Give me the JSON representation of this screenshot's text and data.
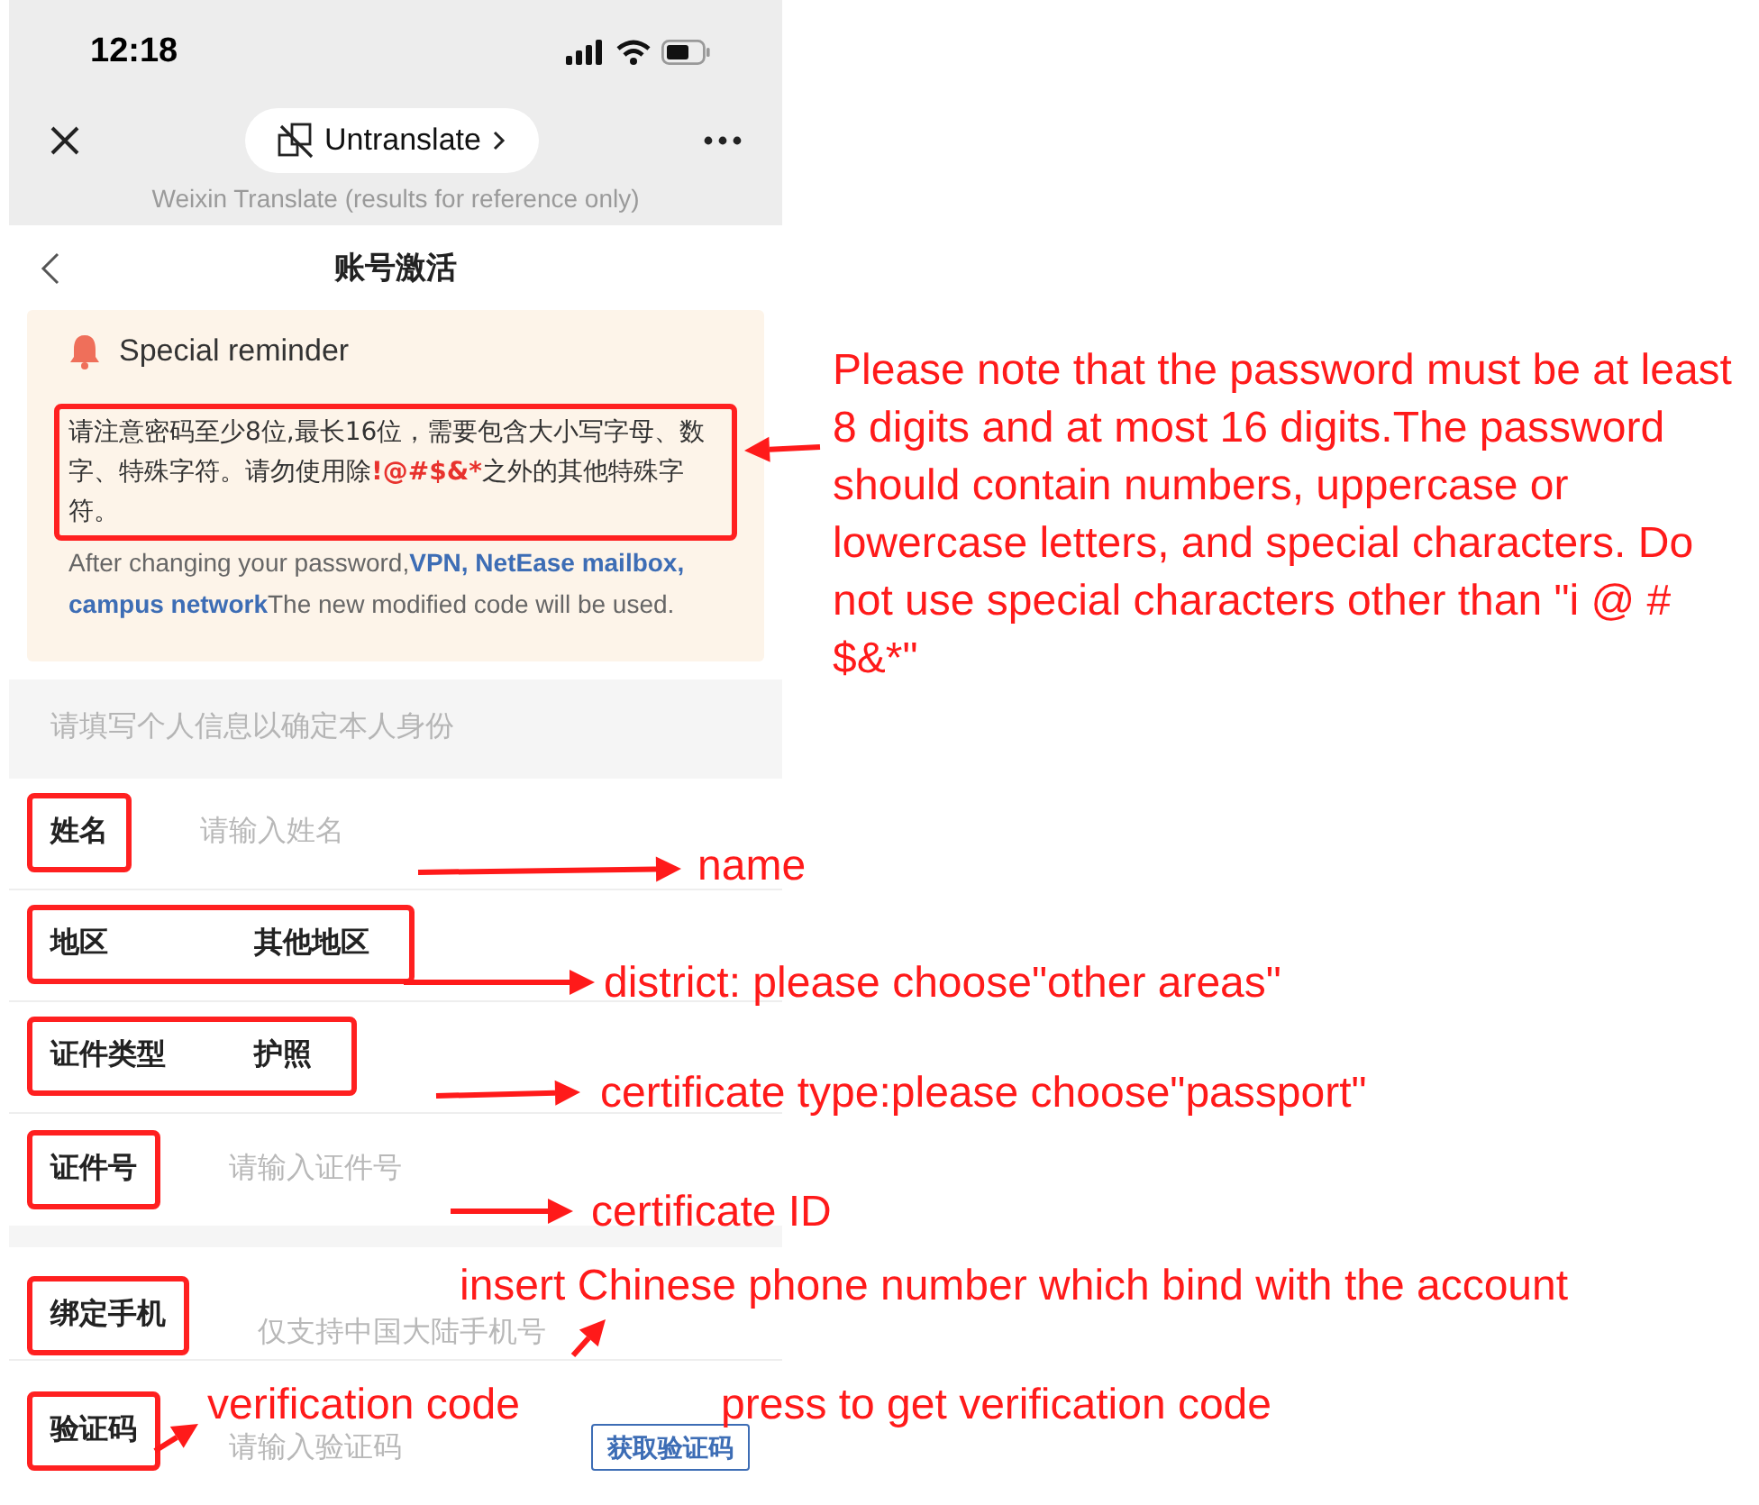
{
  "status_bar": {
    "time": "12:18"
  },
  "translate_bar": {
    "button": "Untranslate",
    "note": "Weixin Translate (results for reference only)"
  },
  "nav": {
    "title": "账号激活"
  },
  "reminder": {
    "title": "Special reminder",
    "warning": {
      "before": "请注意密码至少8位,最长16位，需要包含大小写字母、数字、特殊字符。请勿使用除",
      "special_characters": "!@#$&*",
      "after": "之外的其他特殊字符。"
    },
    "warning_highlighted": true,
    "note": {
      "before": "After changing your password,",
      "services": "VPN, NetEase mailbox, campus network",
      "after": "The new modified code will be used."
    }
  },
  "section_header": "请填写个人信息以确定本人身份",
  "field_groups": [
    {
      "fields": [
        {
          "label": "姓名",
          "kind": "input",
          "placeholder": "请输入姓名",
          "highlighted": true
        },
        {
          "label": "地区",
          "kind": "select",
          "value": "其他地区",
          "highlighted": true
        },
        {
          "label": "证件类型",
          "kind": "select",
          "value": "护照",
          "highlighted": true
        },
        {
          "label": "证件号",
          "kind": "input",
          "placeholder": "请输入证件号",
          "highlighted": true
        }
      ]
    },
    {
      "fields": [
        {
          "label": "绑定手机",
          "kind": "input",
          "placeholder": "仅支持中国大陆手机号",
          "highlighted": true
        },
        {
          "label": "验证码",
          "kind": "code",
          "placeholder": "请输入验证码",
          "button": "获取验证码",
          "highlighted": true
        }
      ]
    }
  ],
  "annotations": [
    {
      "text": "Please note that the password must be at least 8 digits and at most 16 digits.The password should contain numbers, uppercase or lowercase letters, and special characters. Do not use special characters other than \"i @ # $&*\""
    },
    {
      "text": "name"
    },
    {
      "text": "district:  please choose\"other areas\""
    },
    {
      "text": "certificate type:please choose\"passport\""
    },
    {
      "text": "certificate ID"
    },
    {
      "text": "insert Chinese phone number which bind with the account"
    },
    {
      "text": "verification code"
    },
    {
      "text": "press to get verification code"
    }
  ]
}
